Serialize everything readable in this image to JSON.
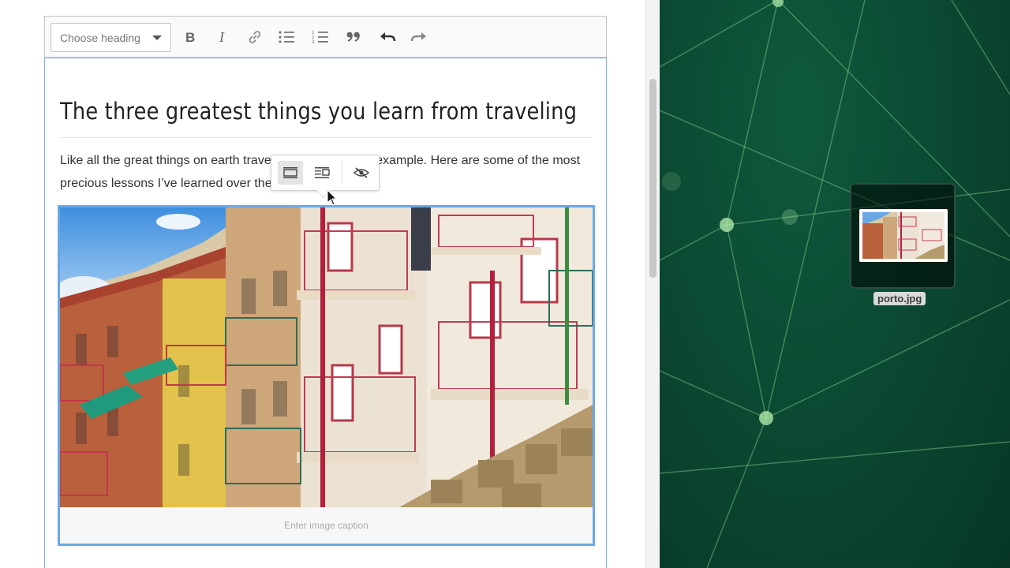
{
  "toolbar": {
    "heading_select": {
      "label": "Choose heading"
    }
  },
  "document": {
    "title": "The three greatest things you learn from traveling",
    "paragraph": "Like all the great things on earth traveling teaches us by example. Here are some of the most precious lessons I’ve learned over the years of traveling."
  },
  "figure": {
    "caption_placeholder": "Enter image caption"
  },
  "desktop": {
    "file_name": "porto.jpg"
  },
  "colors": {
    "focus_border": "#6aa8e6",
    "desktop_background": "#0b4a33"
  }
}
